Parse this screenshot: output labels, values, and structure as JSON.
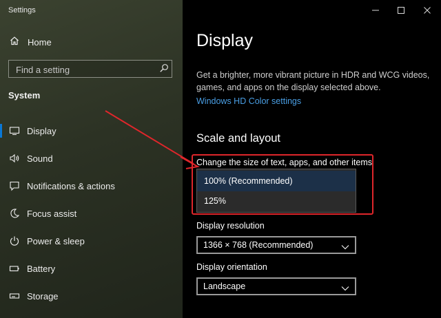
{
  "window": {
    "app_title": "Settings"
  },
  "sidebar": {
    "home_label": "Home",
    "search_placeholder": "Find a setting",
    "section_title": "System",
    "items": [
      {
        "label": "Display",
        "icon": "monitor-icon",
        "active": true
      },
      {
        "label": "Sound",
        "icon": "speaker-icon"
      },
      {
        "label": "Notifications & actions",
        "icon": "notification-icon"
      },
      {
        "label": "Focus assist",
        "icon": "moon-icon"
      },
      {
        "label": "Power & sleep",
        "icon": "power-icon"
      },
      {
        "label": "Battery",
        "icon": "battery-icon"
      },
      {
        "label": "Storage",
        "icon": "storage-icon"
      }
    ]
  },
  "main": {
    "title": "Display",
    "description": "Get a brighter, more vibrant picture in HDR and WCG videos, games, and apps on the display selected above.",
    "hdr_link": "Windows HD Color settings",
    "scale_header": "Scale and layout",
    "scale_label": "Change the size of text, apps, and other items",
    "scale_options": [
      "100% (Recommended)",
      "125%"
    ],
    "scale_selected": "100% (Recommended)",
    "resolution_label": "Display resolution",
    "resolution_value": "1366 × 768 (Recommended)",
    "orientation_label": "Display orientation",
    "orientation_value": "Landscape"
  },
  "colors": {
    "accent": "#0a78d7",
    "link": "#4a9fe5",
    "callout": "#e0262b",
    "arrow": "#e0262b"
  }
}
